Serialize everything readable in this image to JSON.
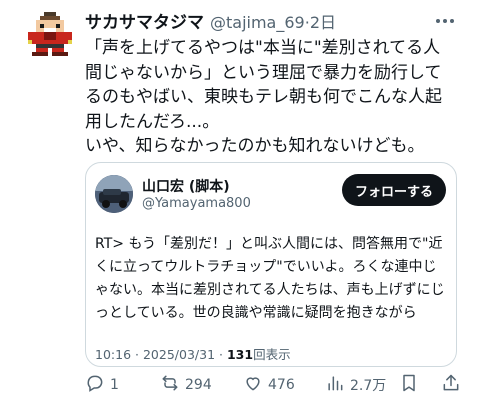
{
  "tweet": {
    "display_name": "サカサマタジマ",
    "handle": "@tajima_69",
    "separator": "·",
    "time": "2日",
    "text_lines": [
      "「声を上げてるやつは\"本当に\"差別されてる人",
      "間じゃないから」という理屈で暴力を励行して",
      "るのもやばい、東映もテレ朝も何でこんな人起",
      "用したんだろ...。",
      "いや、知らなかったのかも知れないけども。"
    ]
  },
  "quote": {
    "display_name": "山口宏 (脚本)",
    "handle": "@Yamayama800",
    "follow_label": "フォローする",
    "text_lines": [
      "RT> もう「差別だ！」と叫ぶ人間には、問答無用で\"近",
      "くに立ってウルトラチョップ\"でいいよ。ろくな連中じ",
      "ゃない。本当に差別されてる人たちは、声も上げずにじ",
      "っとしている。世の良識や常識に疑問を抱きながら"
    ],
    "time": "10:16",
    "date": "2025/03/31",
    "meta_sep": "·",
    "views": "131",
    "views_label": "回表示"
  },
  "actions": {
    "replies": "1",
    "retweets": "294",
    "likes": "476",
    "views": "2.7万"
  },
  "icons": {
    "avatar": "pixel-robot-avatar-icon",
    "more": "more-icon",
    "reply": "reply-icon",
    "retweet": "retweet-icon",
    "like": "heart-icon",
    "views": "views-icon",
    "bookmark": "bookmark-icon",
    "share": "share-icon"
  },
  "colors": {
    "text": "#0f1419",
    "secondary": "#536471",
    "border": "#cfd9de",
    "button_bg": "#0f1419",
    "button_text": "#ffffff"
  }
}
